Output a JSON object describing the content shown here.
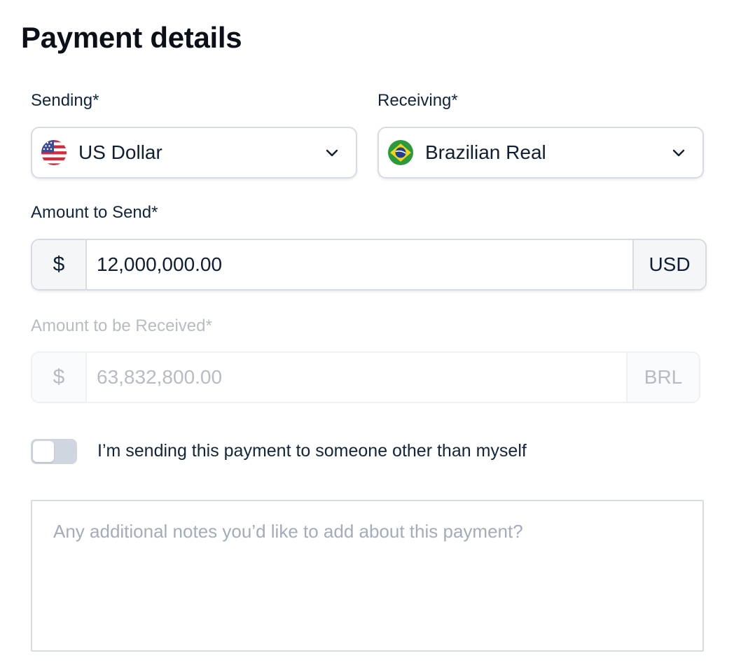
{
  "page": {
    "title": "Payment details"
  },
  "sending": {
    "label": "Sending*",
    "value": "US Dollar",
    "flag_icon": "us-flag-icon"
  },
  "receiving": {
    "label": "Receiving*",
    "value": "Brazilian Real",
    "flag_icon": "brazil-flag-icon"
  },
  "amount_send": {
    "label": "Amount to Send*",
    "prefix": "$",
    "value": "12,000,000.00",
    "currency": "USD"
  },
  "amount_receive": {
    "label": "Amount to be Received*",
    "prefix": "$",
    "value": "63,832,800.00",
    "currency": "BRL",
    "disabled": true
  },
  "toggle": {
    "label": "I’m sending this payment to someone other than myself",
    "checked": false
  },
  "notes": {
    "value": "",
    "placeholder": "Any additional notes you’d like to add about this payment?"
  },
  "colors": {
    "text": "#0f1f33",
    "border": "#d7dce3",
    "addon_bg": "#f4f6f8",
    "disabled_text": "#b7bcc4",
    "toggle_off": "#d0d6e0"
  }
}
